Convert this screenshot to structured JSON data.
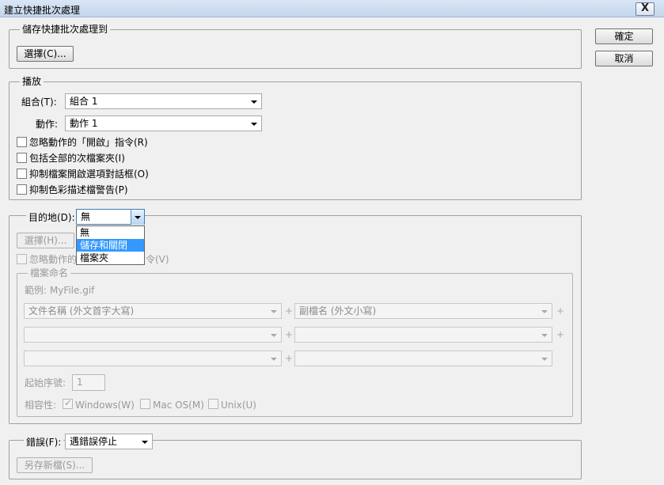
{
  "window": {
    "title": "建立快捷批次處理",
    "close_label": "X"
  },
  "actions": {
    "ok_label": "確定",
    "cancel_label": "取消"
  },
  "save_droplet": {
    "legend": "儲存快捷批次處理到",
    "choose_label": "選擇(C)..."
  },
  "play": {
    "legend": "播放",
    "set_label": "組合(T):",
    "set_value": "組合 1",
    "action_label": "動作:",
    "action_value": "動作 1",
    "checkboxes": [
      {
        "label": "忽略動作的「開啟」指令(R)",
        "checked": false
      },
      {
        "label": "包括全部的次檔案夾(I)",
        "checked": false
      },
      {
        "label": "抑制檔案開啟選項對話框(O)",
        "checked": false
      },
      {
        "label": "抑制色彩描述檔警告(P)",
        "checked": false
      }
    ]
  },
  "destination": {
    "label": "目的地(D):",
    "value": "無",
    "options": [
      "無",
      "儲存和關閉",
      "檔案夾"
    ],
    "selected_option": "儲存和關閉",
    "choose_label": "選擇(H)...",
    "override_label_visible": "忽略動作的",
    "override_label_tail": "令(V)"
  },
  "file_naming": {
    "legend": "檔案命名",
    "example_label": "範例: MyFile.gif",
    "field1": "文件名稱 (外文首字大寫)",
    "field2": "副檔名 (外文小寫)",
    "plus": "+",
    "start_serial_label": "起始序號:",
    "start_serial_value": "1",
    "compat_label": "相容性:",
    "compat": [
      {
        "label": "Windows(W)",
        "checked": true
      },
      {
        "label": "Mac OS(M)",
        "checked": false
      },
      {
        "label": "Unix(U)",
        "checked": false
      }
    ],
    "check_glyph": "✓"
  },
  "errors": {
    "label": "錯誤(F):",
    "value": "遇錯誤停止",
    "save_as_label": "另存新檔(S)..."
  }
}
